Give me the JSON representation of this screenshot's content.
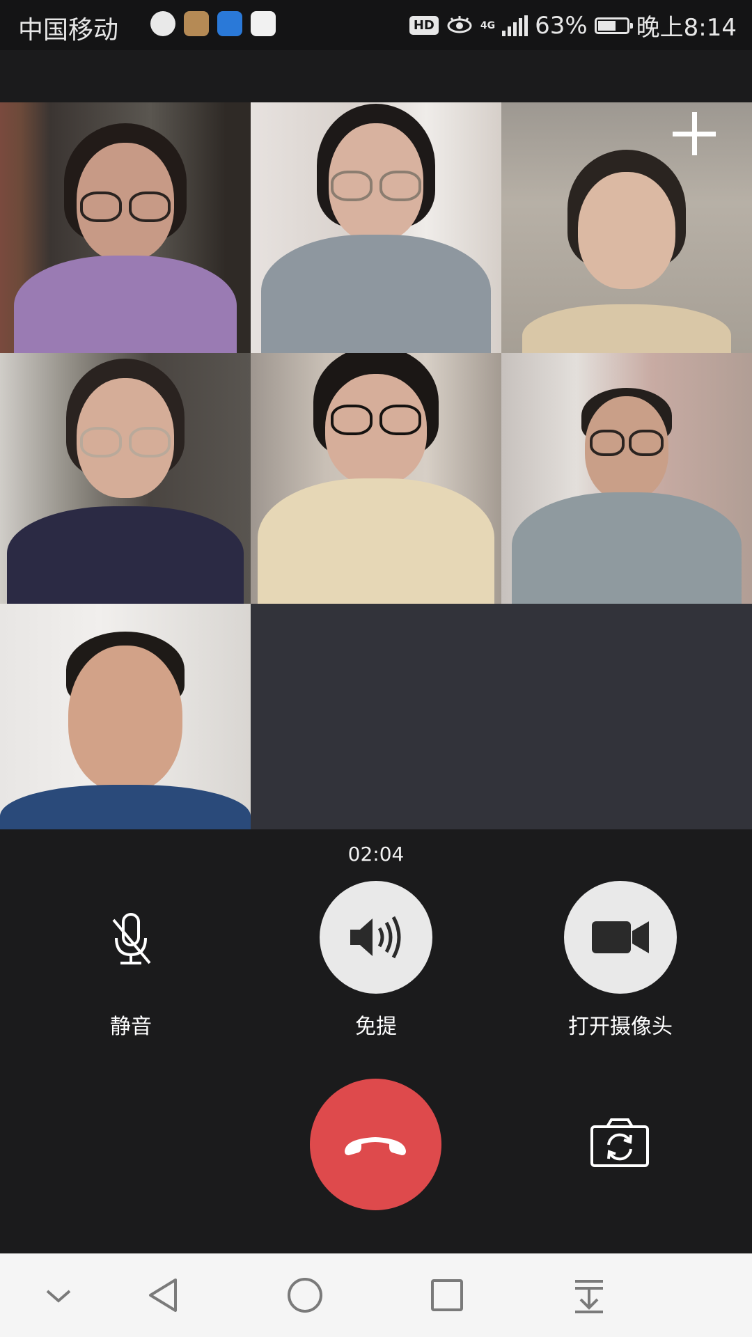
{
  "status_bar": {
    "carrier": "中国移动",
    "hd_badge": "HD",
    "network": "4G",
    "battery_text": "63%",
    "battery_level": 0.63,
    "time": "晚上8:14",
    "notification_icons": [
      "feather-app-icon",
      "huawei-app-icon",
      "shield-app-icon",
      "baidu-map-app-icon"
    ]
  },
  "call": {
    "duration": "02:04",
    "participants_shown": 7,
    "add_participant_icon": "plus-icon"
  },
  "controls": {
    "mute_label": "静音",
    "speaker_label": "免提",
    "camera_label": "打开摄像头",
    "hangup_icon": "phone-hangup-icon",
    "switch_camera_icon": "camera-switch-icon"
  },
  "navigation_bar": {
    "buttons": [
      "chevron-down-icon",
      "back-triangle-icon",
      "home-circle-icon",
      "recents-square-icon",
      "pull-down-icon"
    ]
  },
  "colors": {
    "background": "#1b1b1c",
    "empty_tile": "#32333a",
    "hangup_red": "#de4a4c",
    "control_circle": "#e9e9e9",
    "nav_bar": "#f5f5f5"
  }
}
